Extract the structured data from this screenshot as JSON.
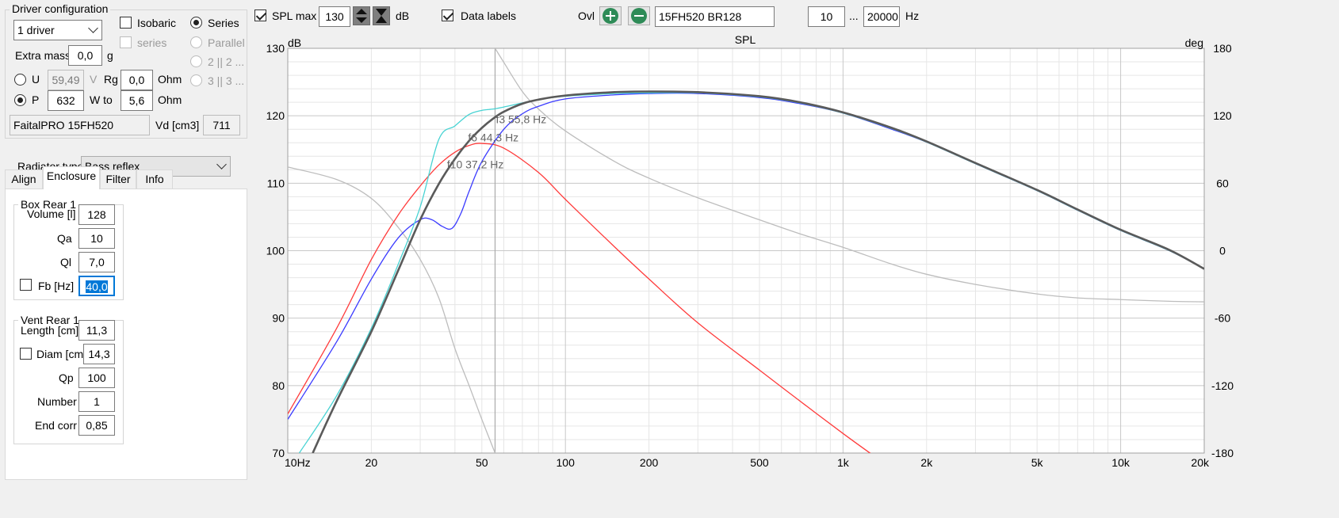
{
  "driver_config": {
    "title": "Driver configuration",
    "driver_count": "1 driver",
    "isobaric_label": "Isobaric",
    "series_label": "Series",
    "series_sub_label": "series",
    "parallel_label": "Parallel",
    "opt_2_2": "2 || 2 ...",
    "opt_3_3": "3 || 3 ...",
    "extra_mass_label": "Extra mass",
    "extra_mass_value": "0,0",
    "extra_mass_unit": "g",
    "u_label": "U",
    "u_value": "59,49",
    "u_unit": "V",
    "rg_label": "Rg",
    "rg_value": "0,0",
    "rg_unit": "Ohm",
    "p_label": "P",
    "p_value": "632",
    "p_unit": "W to",
    "to_value": "5,6",
    "to_unit": "Ohm",
    "driver_name": "FaitalPRO 15FH520",
    "vd_label": "Vd [cm3]",
    "vd_value": "711"
  },
  "radiator": {
    "label": "Radiator type",
    "value": "Bass reflex"
  },
  "tabs": [
    {
      "label": "Align"
    },
    {
      "label": "Enclosure"
    },
    {
      "label": "Filter"
    },
    {
      "label": "Info"
    }
  ],
  "box": {
    "title": "Box Rear 1",
    "volume_label": "Volume [l]",
    "volume_value": "128",
    "qa_label": "Qa",
    "qa_value": "10",
    "ql_label": "Ql",
    "ql_value": "7,0",
    "fb_label": "Fb [Hz]",
    "fb_value": "40,0"
  },
  "vent": {
    "title": "Vent Rear 1",
    "length_label": "Length [cm]",
    "length_value": "11,3",
    "diam_label": "Diam [cm]",
    "diam_value": "14,3",
    "qp_label": "Qp",
    "qp_value": "100",
    "number_label": "Number",
    "number_value": "1",
    "endcorr_label": "End corr",
    "endcorr_value": "0,85"
  },
  "toolbar": {
    "spl_max_label": "SPL max",
    "spl_max_value": "130",
    "db_unit": "dB",
    "data_labels_label": "Data labels",
    "ovl_label": "Ovl",
    "project_name": "15FH520 BR128",
    "freq_min": "10",
    "freq_sep": "...",
    "freq_max": "20000",
    "freq_unit": "Hz"
  },
  "chart_data": {
    "type": "line",
    "title": "SPL",
    "ylabel": "dB",
    "y2label": "deg",
    "xscale": "log",
    "xlim": [
      10,
      20000
    ],
    "ylim": [
      70,
      130
    ],
    "y2lim": [
      -180,
      180
    ],
    "grid": true,
    "x_ticks": [
      {
        "value": 10,
        "label": "10Hz"
      },
      {
        "value": 20,
        "label": "20"
      },
      {
        "value": 50,
        "label": "50"
      },
      {
        "value": 100,
        "label": "100"
      },
      {
        "value": 200,
        "label": "200"
      },
      {
        "value": 500,
        "label": "500"
      },
      {
        "value": 1000,
        "label": "1k"
      },
      {
        "value": 2000,
        "label": "2k"
      },
      {
        "value": 5000,
        "label": "5k"
      },
      {
        "value": 10000,
        "label": "10k"
      },
      {
        "value": 20000,
        "label": "20k"
      }
    ],
    "y_ticks": [
      {
        "value": 70,
        "label": "70"
      },
      {
        "value": 80,
        "label": "80"
      },
      {
        "value": 90,
        "label": "90"
      },
      {
        "value": 100,
        "label": "100"
      },
      {
        "value": 110,
        "label": "110"
      },
      {
        "value": 120,
        "label": "120"
      },
      {
        "value": 130,
        "label": "130"
      }
    ],
    "y2_ticks": [
      {
        "value": -180,
        "label": "-180"
      },
      {
        "value": -120,
        "label": "-120"
      },
      {
        "value": -60,
        "label": "-60"
      },
      {
        "value": 0,
        "label": "0"
      },
      {
        "value": 60,
        "label": "60"
      },
      {
        "value": 120,
        "label": "120"
      },
      {
        "value": 180,
        "label": "180"
      }
    ],
    "series": [
      {
        "color": "#ff3b3b",
        "x": [
          10,
          15,
          20,
          25,
          30,
          35,
          40,
          45,
          50,
          60,
          80,
          100,
          150,
          200,
          300,
          500,
          700,
          1000,
          1300
        ],
        "y": [
          75.8,
          88.5,
          98.7,
          105.3,
          109.6,
          112.7,
          114.6,
          115.6,
          115.9,
          115.2,
          111.6,
          107.6,
          100.6,
          95.8,
          89.3,
          82.3,
          77.7,
          72.9,
          69.5
        ]
      },
      {
        "color": "#3b3bff",
        "x": [
          10,
          15,
          20,
          25,
          30,
          33,
          36,
          39,
          42,
          45,
          50,
          60,
          70,
          80,
          100,
          150,
          200,
          300,
          500,
          700,
          1000,
          1500,
          2000,
          3000,
          5000,
          7000,
          10000,
          15000,
          20000
        ],
        "y": [
          75.0,
          86.5,
          95.8,
          101.9,
          104.6,
          104.6,
          103.6,
          103.3,
          105.5,
          108.8,
          113.2,
          118.0,
          120.3,
          121.4,
          122.5,
          123.1,
          123.3,
          123.3,
          122.7,
          121.8,
          120.4,
          118.0,
          116.1,
          112.9,
          108.9,
          106.0,
          103.0,
          100.0,
          97.3
        ]
      },
      {
        "color": "#47d3d3",
        "x": [
          11,
          15,
          20,
          25,
          30,
          35,
          40,
          45,
          50,
          55,
          60,
          80,
          100,
          150,
          200,
          300,
          500,
          700,
          1000,
          1500,
          2000,
          3000,
          5000,
          7000,
          10000,
          15000,
          20000
        ],
        "y": [
          70.0,
          78.5,
          88.5,
          98.0,
          106.5,
          116.5,
          118.5,
          120.2,
          120.8,
          121.0,
          121.3,
          122.4,
          122.9,
          123.3,
          123.4,
          123.4,
          122.8,
          121.9,
          120.4,
          118.1,
          116.1,
          112.9,
          108.9,
          106.0,
          103.0,
          100.0,
          97.3
        ]
      },
      {
        "color": "#5a5a5a",
        "x": [
          12.3,
          15,
          20,
          25,
          30,
          35,
          40,
          45,
          50,
          55,
          60,
          70,
          80,
          100,
          150,
          200,
          300,
          500,
          700,
          1000,
          1500,
          2000,
          3000,
          5000,
          7000,
          10000,
          15000,
          20000
        ],
        "y": [
          70.0,
          77.7,
          88.0,
          97.1,
          104.6,
          109.9,
          113.6,
          116.3,
          118.2,
          119.6,
          120.6,
          121.8,
          122.4,
          123.0,
          123.5,
          123.6,
          123.5,
          122.9,
          122.0,
          120.5,
          118.2,
          116.2,
          113.0,
          109.0,
          106.1,
          103.1,
          100.1,
          97.3
        ]
      },
      {
        "color": "#bdbdbd",
        "axis": "y2",
        "x": [
          10,
          15,
          20,
          25,
          30,
          35,
          40,
          45,
          50,
          55.8
        ],
        "y": [
          74.4,
          63.3,
          46.5,
          20.7,
          -7.8,
          -42.0,
          -87.0,
          -120.0,
          -150.0,
          -180.0
        ]
      },
      {
        "color": "#bdbdbd",
        "axis": "y2",
        "x": [
          55.8,
          60,
          70,
          80,
          100,
          150,
          200,
          300,
          500,
          700,
          1000,
          1500,
          2000,
          3000,
          5000,
          7000,
          10000,
          15000,
          20000
        ],
        "y": [
          180.0,
          167.5,
          141.5,
          126.0,
          106.5,
          79.5,
          64.5,
          47.0,
          27.5,
          15.0,
          3.0,
          -12.0,
          -21.0,
          -30.0,
          -38.5,
          -42.0,
          -43.5,
          -45.0,
          -45.5
        ]
      }
    ],
    "vline": {
      "x": 55.8,
      "color": "#aaaaaa"
    },
    "annotations": [
      {
        "text": "f3 55,8 Hz",
        "x": 55.8,
        "y": 119.5
      },
      {
        "text": "f6 44,3 Hz",
        "x": 44.3,
        "y": 116.8
      },
      {
        "text": "f10 37,2 Hz",
        "x": 37.2,
        "y": 112.8
      }
    ]
  },
  "colors": {
    "background": "#f0f0f0",
    "plot_bg": "#ffffff",
    "grid_major": "#c8c8c8",
    "grid_minor": "#e6e6e6",
    "accent_green": "#2e8b57",
    "selection_blue": "#0078d7"
  }
}
